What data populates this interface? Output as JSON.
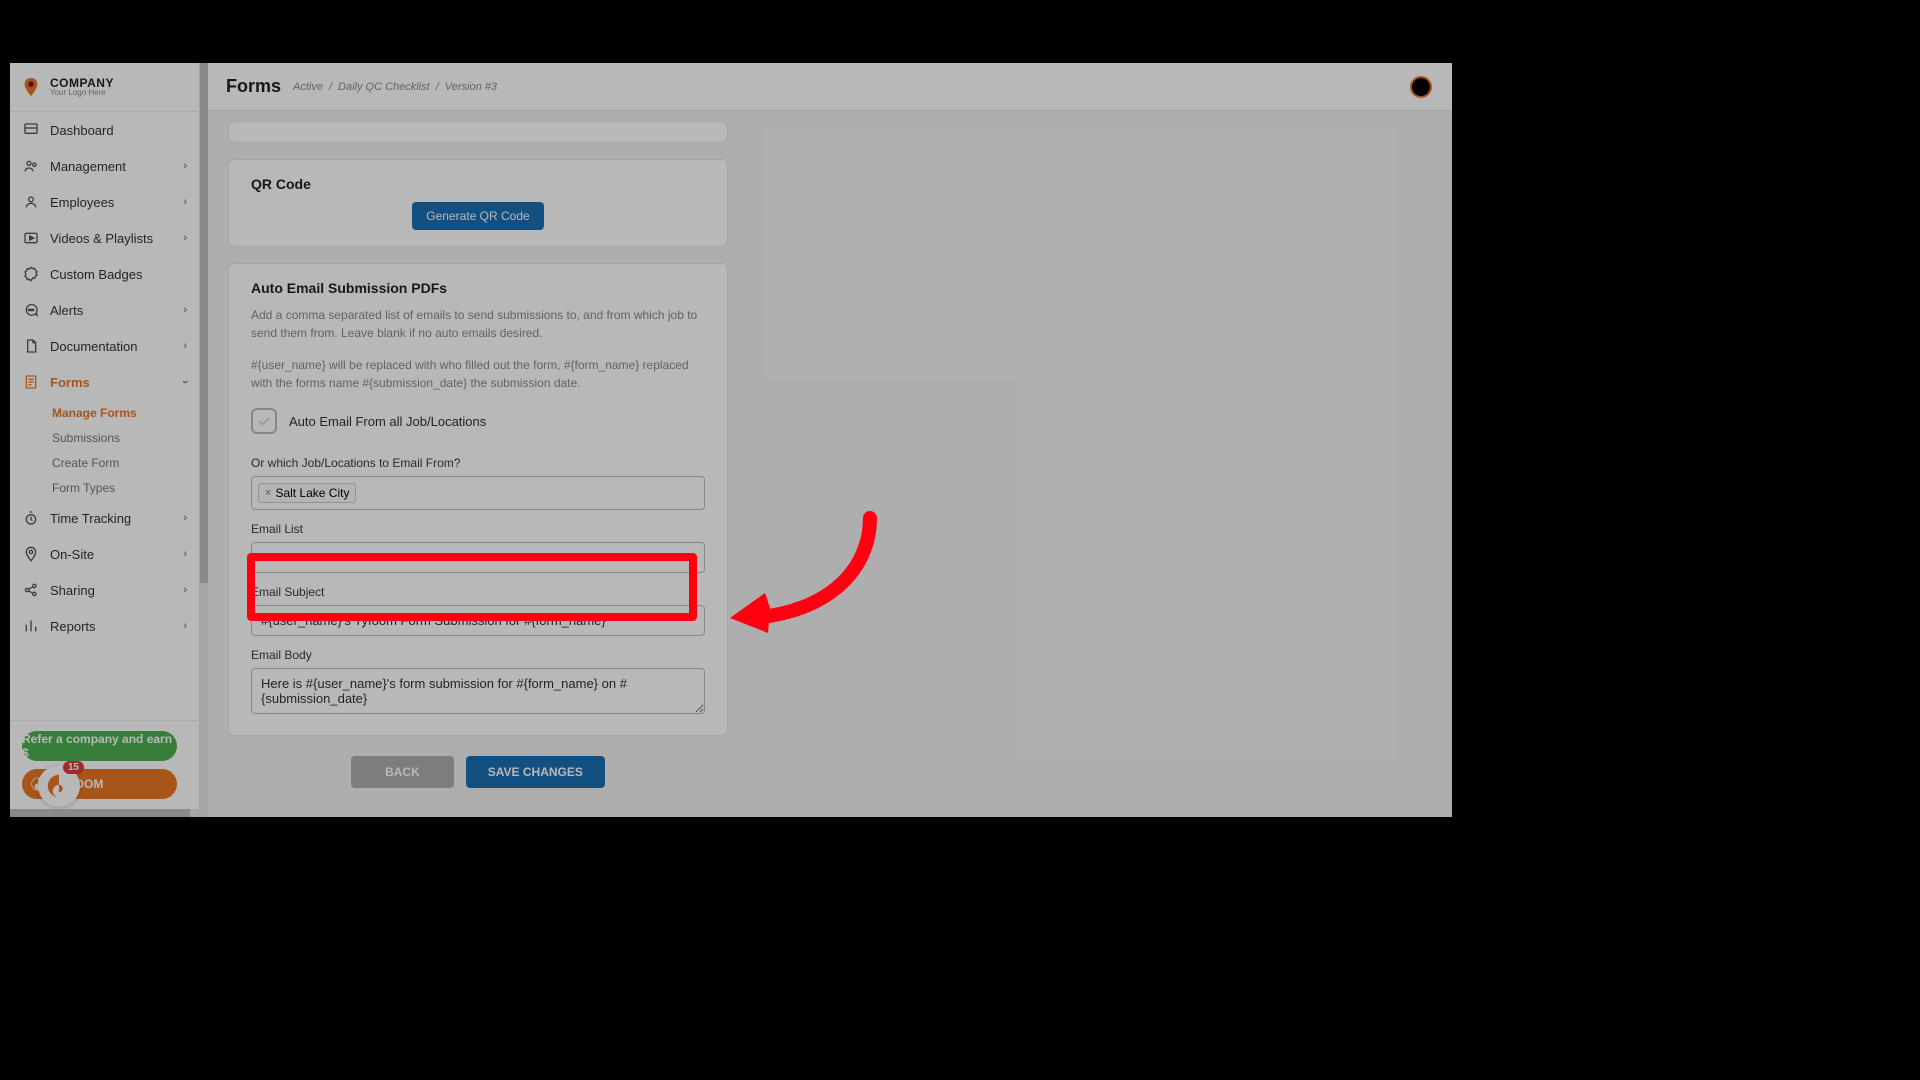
{
  "logo": {
    "title": "COMPANY",
    "subtitle": "Your Logo Here"
  },
  "sidebar": {
    "items": [
      {
        "label": "Dashboard",
        "expandable": false
      },
      {
        "label": "Management",
        "expandable": true
      },
      {
        "label": "Employees",
        "expandable": true
      },
      {
        "label": "Videos & Playlists",
        "expandable": true
      },
      {
        "label": "Custom Badges",
        "expandable": false
      },
      {
        "label": "Alerts",
        "expandable": true
      },
      {
        "label": "Documentation",
        "expandable": true
      },
      {
        "label": "Forms",
        "expandable": true,
        "active": true
      },
      {
        "label": "Time Tracking",
        "expandable": true
      },
      {
        "label": "On-Site",
        "expandable": true
      },
      {
        "label": "Sharing",
        "expandable": true
      },
      {
        "label": "Reports",
        "expandable": true
      }
    ],
    "forms_subitems": [
      {
        "label": "Manage Forms",
        "active": true
      },
      {
        "label": "Submissions"
      },
      {
        "label": "Create Form"
      },
      {
        "label": "Form Types"
      }
    ],
    "refer_label": "Refer a company and earn $",
    "brand_label": "TYFOOM",
    "notification_count": "15"
  },
  "header": {
    "title": "Forms",
    "crumbs": [
      "Active",
      "Daily QC Checklist",
      "Version #3"
    ]
  },
  "qr": {
    "title": "QR Code",
    "button": "Generate QR Code"
  },
  "email": {
    "title": "Auto Email Submission PDFs",
    "desc1": "Add a comma separated list of emails to send submissions to, and from which job to send them from. Leave blank if no auto emails desired.",
    "desc2": "#{user_name} will be replaced with who filled out the form, #{form_name} replaced with the forms name #{submission_date} the submission date.",
    "check_label": "Auto Email From all Job/Locations",
    "jobs_label": "Or which Job/Locations to Email From?",
    "jobs_tags": [
      "Salt Lake City"
    ],
    "list_label": "Email List",
    "list_value": "",
    "subject_label": "Email Subject",
    "subject_value": "#{user_name}'s Tyfoom Form Submission for #{form_name}",
    "body_label": "Email Body",
    "body_value": "Here is #{user_name}'s form submission for #{form_name} on #{submission_date}"
  },
  "buttons": {
    "back": "BACK",
    "save": "SAVE CHANGES"
  }
}
